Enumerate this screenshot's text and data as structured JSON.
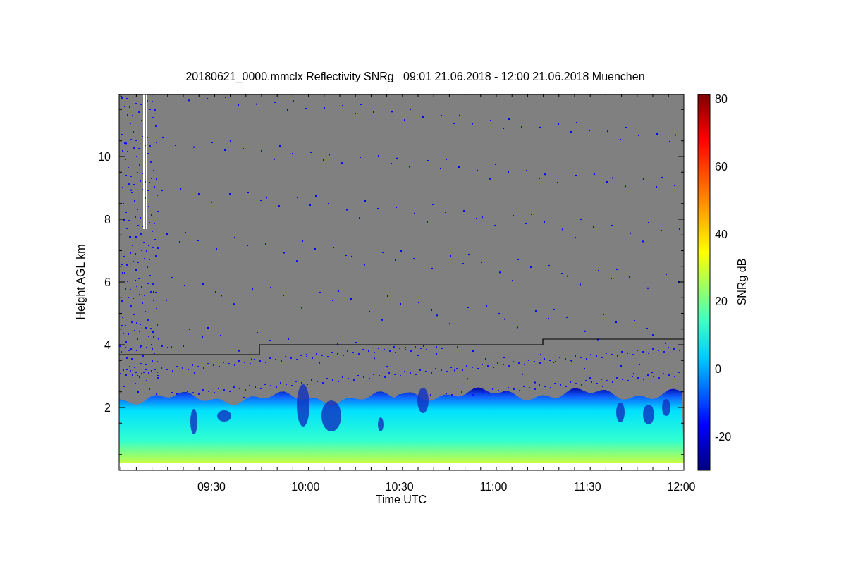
{
  "title": "20180621_0000.mmclx Reflectivity SNRg   09:01 21.06.2018 - 12:00 21.06.2018 Muenchen",
  "y_axis": {
    "label": "Height AGL km",
    "ticks": [
      "10",
      "8",
      "6",
      "4",
      "2"
    ]
  },
  "x_axis": {
    "label": "Time UTC",
    "ticks": [
      "09:30",
      "10:00",
      "10:30",
      "11:00",
      "11:30",
      "12:00"
    ]
  },
  "colorbar": {
    "label": "SNRg dB",
    "ticks": [
      "80",
      "60",
      "40",
      "20",
      "0",
      "-20"
    ]
  }
}
